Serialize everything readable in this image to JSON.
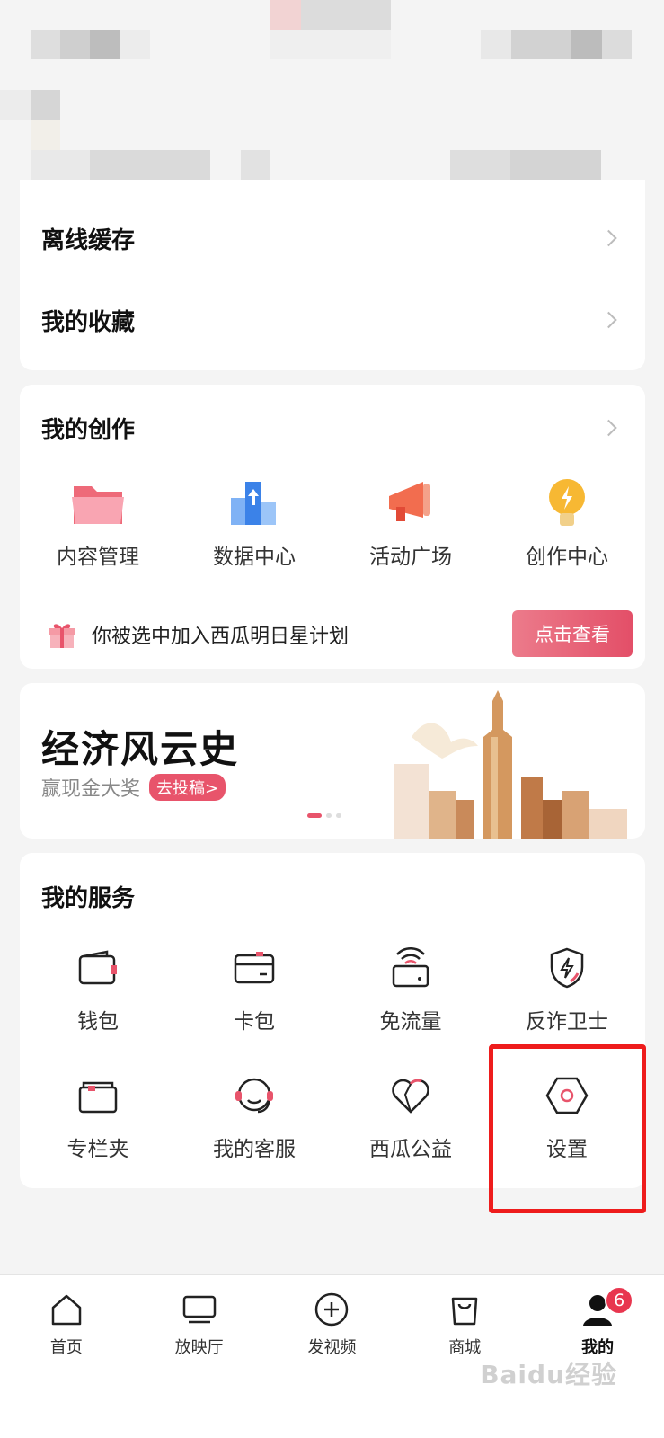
{
  "menu": {
    "offline_cache": "离线缓存",
    "favorites": "我的收藏"
  },
  "creation": {
    "title": "我的创作",
    "items": [
      {
        "label": "内容管理",
        "icon": "folder-icon"
      },
      {
        "label": "数据中心",
        "icon": "data-chart-icon"
      },
      {
        "label": "活动广场",
        "icon": "megaphone-icon"
      },
      {
        "label": "创作中心",
        "icon": "lightbulb-icon"
      }
    ],
    "promo_text": "你被选中加入西瓜明日星计划",
    "promo_button": "点击查看"
  },
  "banner": {
    "title": "经济风云史",
    "subtitle": "赢现金大奖",
    "tag": "去投稿>"
  },
  "services": {
    "title": "我的服务",
    "items": [
      {
        "label": "钱包",
        "icon": "wallet-icon"
      },
      {
        "label": "卡包",
        "icon": "card-icon"
      },
      {
        "label": "免流量",
        "icon": "wifi-router-icon"
      },
      {
        "label": "反诈卫士",
        "icon": "shield-icon"
      },
      {
        "label": "专栏夹",
        "icon": "column-folder-icon"
      },
      {
        "label": "我的客服",
        "icon": "headset-icon"
      },
      {
        "label": "西瓜公益",
        "icon": "heart-icon"
      },
      {
        "label": "设置",
        "icon": "settings-icon"
      }
    ]
  },
  "tabbar": {
    "items": [
      {
        "label": "首页",
        "icon": "home-icon"
      },
      {
        "label": "放映厅",
        "icon": "tv-icon"
      },
      {
        "label": "发视频",
        "icon": "plus-circle-icon"
      },
      {
        "label": "商城",
        "icon": "shopping-bag-icon"
      },
      {
        "label": "我的",
        "icon": "profile-icon",
        "badge": "6",
        "active": true
      }
    ]
  },
  "watermark": "Baidu经验",
  "colors": {
    "accent": "#e8546b",
    "highlight_box": "#ee1c1c",
    "background": "#f4f4f4"
  }
}
